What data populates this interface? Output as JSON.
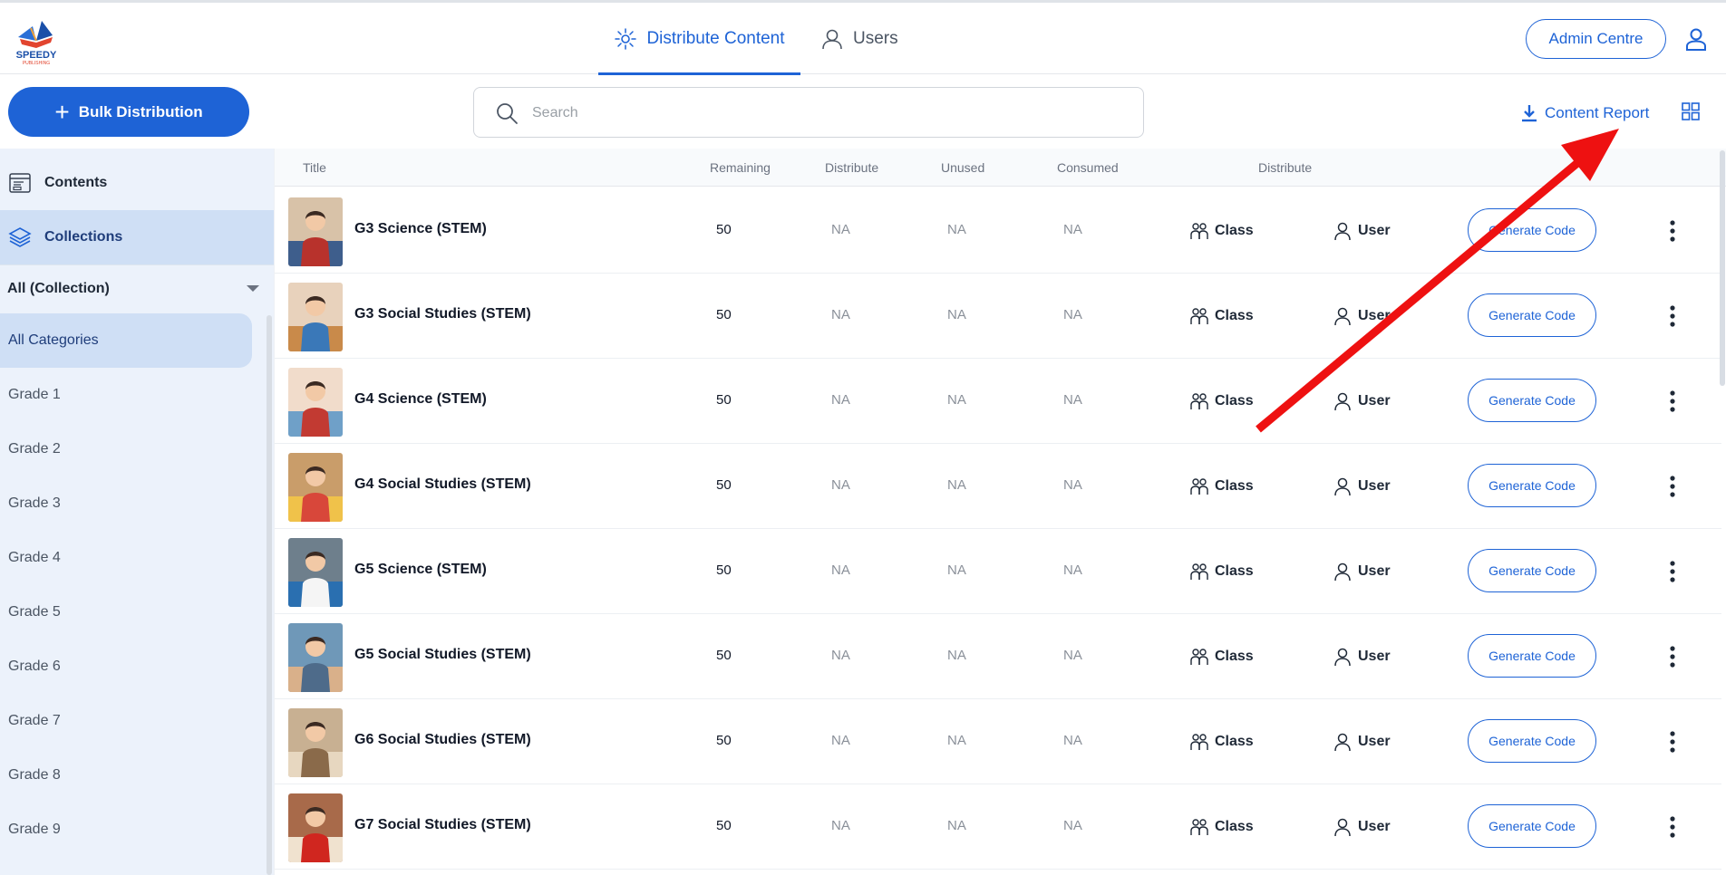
{
  "header": {
    "logo_text": "SPEEDY",
    "logo_subtext": "PUBLISHING",
    "nav": [
      {
        "label": "Distribute Content",
        "icon": "distribute-icon",
        "active": true
      },
      {
        "label": "Users",
        "icon": "user-icon",
        "active": false
      }
    ],
    "admin_button": "Admin Centre",
    "profile_icon": "person-icon"
  },
  "toolbar": {
    "bulk_button": "Bulk Distribution",
    "bulk_icon": "plus-icon",
    "search_placeholder": "Search",
    "content_report": "Content Report",
    "content_report_icon": "download-icon",
    "view_toggle_icon": "grid-view-icon"
  },
  "sidebar": {
    "items": [
      {
        "label": "Contents",
        "icon": "contents-icon",
        "selected": false
      },
      {
        "label": "Collections",
        "icon": "layers-icon",
        "selected": true
      }
    ],
    "collection_filter": "All (Collection)",
    "categories": [
      "All Categories",
      "Grade 1",
      "Grade 2",
      "Grade 3",
      "Grade 4",
      "Grade 5",
      "Grade 6",
      "Grade 7",
      "Grade 8",
      "Grade 9"
    ],
    "selected_category": "All Categories"
  },
  "table": {
    "columns": [
      "Title",
      "Remaining",
      "Distribute",
      "Unused",
      "Consumed",
      "Distribute"
    ],
    "class_label": "Class",
    "user_label": "User",
    "generate_label": "Generate Code",
    "rows": [
      {
        "title": "G3 Science (STEM)",
        "remaining": "50",
        "distribute": "NA",
        "unused": "NA",
        "consumed": "NA"
      },
      {
        "title": "G3 Social Studies (STEM)",
        "remaining": "50",
        "distribute": "NA",
        "unused": "NA",
        "consumed": "NA"
      },
      {
        "title": "G4 Science (STEM)",
        "remaining": "50",
        "distribute": "NA",
        "unused": "NA",
        "consumed": "NA"
      },
      {
        "title": "G4 Social Studies (STEM)",
        "remaining": "50",
        "distribute": "NA",
        "unused": "NA",
        "consumed": "NA"
      },
      {
        "title": "G5 Science (STEM)",
        "remaining": "50",
        "distribute": "NA",
        "unused": "NA",
        "consumed": "NA"
      },
      {
        "title": "G5 Social Studies (STEM)",
        "remaining": "50",
        "distribute": "NA",
        "unused": "NA",
        "consumed": "NA"
      },
      {
        "title": "G6 Social Studies (STEM)",
        "remaining": "50",
        "distribute": "NA",
        "unused": "NA",
        "consumed": "NA"
      },
      {
        "title": "G7 Social Studies (STEM)",
        "remaining": "50",
        "distribute": "NA",
        "unused": "NA",
        "consumed": "NA"
      }
    ]
  },
  "colors": {
    "accent": "#1e63d6",
    "sidebar_bg": "#ecf2fb",
    "selected_bg": "#cfdff5",
    "annotation_arrow": "#ee1111"
  }
}
